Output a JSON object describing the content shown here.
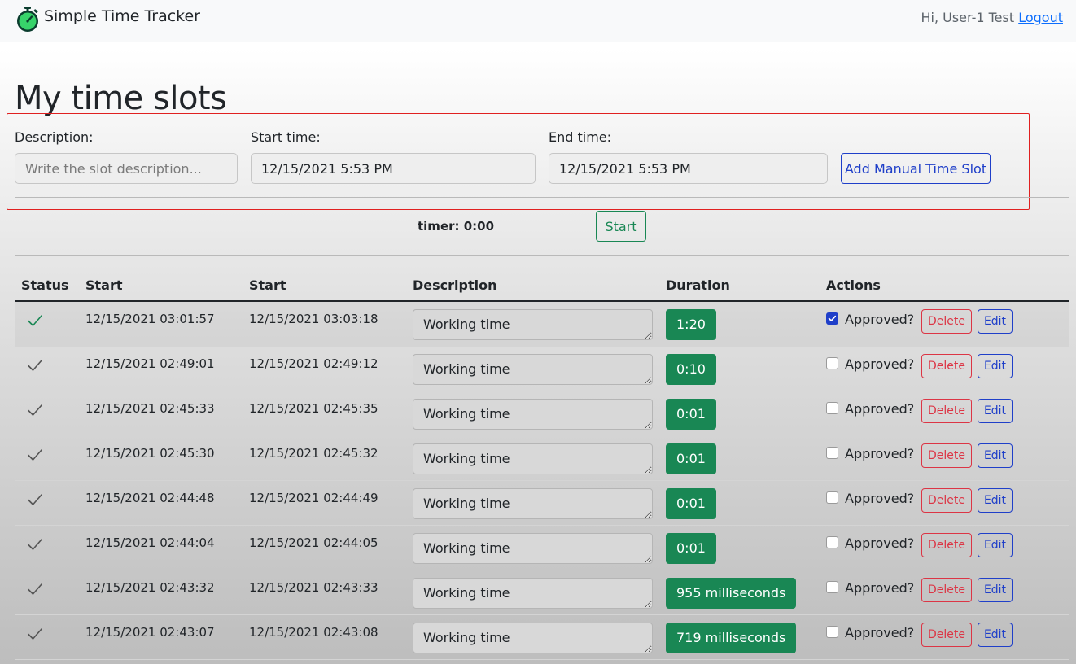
{
  "navbar": {
    "brand": "Simple Time Tracker",
    "greeting": "Hi, User-1 Test",
    "logout": "Logout"
  },
  "page": {
    "title": "My time slots"
  },
  "form": {
    "description_label": "Description:",
    "description_placeholder": "Write the slot description...",
    "start_label": "Start time:",
    "start_value": "12/15/2021 5:53 PM",
    "end_label": "End time:",
    "end_value": "12/15/2021 5:53 PM",
    "add_button": "Add Manual Time Slot"
  },
  "timer": {
    "text": "timer: 0:00",
    "start_button": "Start"
  },
  "table": {
    "headers": [
      "Status",
      "Start",
      "Start",
      "Description",
      "Duration",
      "Actions"
    ],
    "approved_label": "Approved?",
    "delete_label": "Delete",
    "edit_label": "Edit",
    "rows": [
      {
        "start": "12/15/2021 03:01:57",
        "end": "12/15/2021 03:03:18",
        "description": "Working time",
        "duration": "1:20",
        "approved": true,
        "status": "green"
      },
      {
        "start": "12/15/2021 02:49:01",
        "end": "12/15/2021 02:49:12",
        "description": "Working time",
        "duration": "0:10",
        "approved": false,
        "status": "gray"
      },
      {
        "start": "12/15/2021 02:45:33",
        "end": "12/15/2021 02:45:35",
        "description": "Working time",
        "duration": "0:01",
        "approved": false,
        "status": "gray"
      },
      {
        "start": "12/15/2021 02:45:30",
        "end": "12/15/2021 02:45:32",
        "description": "Working time",
        "duration": "0:01",
        "approved": false,
        "status": "gray"
      },
      {
        "start": "12/15/2021 02:44:48",
        "end": "12/15/2021 02:44:49",
        "description": "Working time",
        "duration": "0:01",
        "approved": false,
        "status": "gray"
      },
      {
        "start": "12/15/2021 02:44:04",
        "end": "12/15/2021 02:44:05",
        "description": "Working time",
        "duration": "0:01",
        "approved": false,
        "status": "gray"
      },
      {
        "start": "12/15/2021 02:43:32",
        "end": "12/15/2021 02:43:33",
        "description": "Working time",
        "duration": "955 milliseconds",
        "approved": false,
        "status": "gray"
      },
      {
        "start": "12/15/2021 02:43:07",
        "end": "12/15/2021 02:43:08",
        "description": "Working time",
        "duration": "719 milliseconds",
        "approved": false,
        "status": "gray"
      }
    ]
  },
  "colors": {
    "status_green": "#198754",
    "status_gray": "#555555",
    "highlight": "#e02020"
  },
  "icons": {
    "brand": "stopwatch-icon",
    "status": "check-icon",
    "checkbox_checked": "check-icon"
  }
}
